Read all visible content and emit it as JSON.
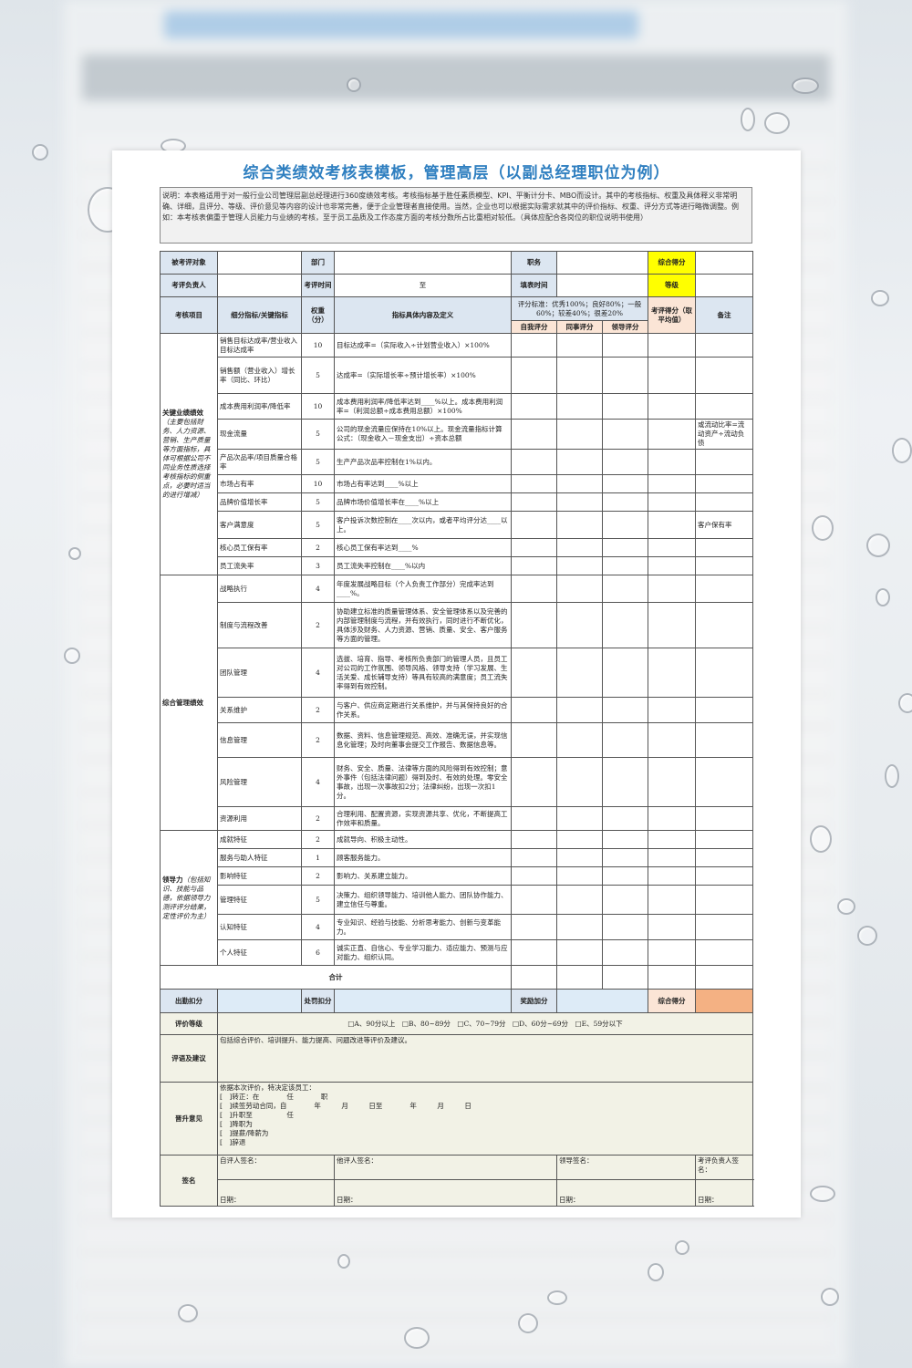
{
  "title": "综合类绩效考核表模板，管理高层（以副总经理职位为例）",
  "description": "说明：本表格适用于对一般行业公司管理层副总经理进行360度绩效考核。考核指标基于胜任素质模型、KPI、平衡计分卡、MBO而设计。其中的考核指标、权重及具体释义非常明确、详细，且评分、等级、评价意见等内容的设计也非常完善，便于企业管理者直接使用。当然，企业也可以根据实际需求就其中的评价指标、权重、评分方式等进行略微调整。例如：本考核表偏重于管理人员能力与业绩的考核，至于员工品质及工作态度方面的考核分数所占比重相对较低。（具体应配合各岗位的职位说明书使用）",
  "header": {
    "target_label": "被考评对象",
    "dept_label": "部门",
    "position_label": "职务",
    "total_score_label": "综合得分",
    "owner_label": "考评负责人",
    "period_label": "考评时间",
    "to_label": "至",
    "fill_time_label": "填表时间",
    "grade_label": "等级"
  },
  "columns": {
    "item": "考核项目",
    "sub": "细分指标/关键指标",
    "weight": "权重（分）",
    "definition": "指标具体内容及定义",
    "standard": "评分标准：优秀100%；良好80%；一般60%；较差40%；很差20%",
    "self": "自我评分",
    "peer": "同事评分",
    "leader": "领导评分",
    "score": "考评得分（取平均值）",
    "remark": "备注"
  },
  "sections": [
    {
      "name": "关键业绩绩效",
      "note": "（主要包括财务、人力资源、营销、生产质量等方面指标，具体可根据公司不同业务性质选择考核指标的侧重点，必要时适当的进行增减）",
      "rows": [
        {
          "sub": "销售目标达成率/营业收入目标达成率",
          "weight": "10",
          "def": "目标达成率=（实际收入÷计划营业收入）×100%",
          "remark": ""
        },
        {
          "sub": "销售额（营业收入）增长率（同比、环比）",
          "weight": "5",
          "def": "达成率=（实际增长率÷预计增长率）×100%",
          "remark": ""
        },
        {
          "sub": "成本费用利润率/降低率",
          "weight": "10",
          "def": "成本费用利润率/降低率达到____%以上。成本费用利润率=（利润总额÷成本费用总额）×100%",
          "remark": ""
        },
        {
          "sub": "现金流量",
          "weight": "5",
          "def": "公司的现金流量应保持在10%以上。现金流量指标计算公式：（现金收入－现金支出）÷资本总额",
          "remark": "或流动比率=流动资产÷流动负债"
        },
        {
          "sub": "产品次品率/项目质量合格率",
          "weight": "5",
          "def": "生产产品次品率控制在1%以内。",
          "remark": ""
        },
        {
          "sub": "市场占有率",
          "weight": "10",
          "def": "市场占有率达到____%以上",
          "remark": ""
        },
        {
          "sub": "品牌价值增长率",
          "weight": "5",
          "def": "品牌市场价值增长率在____%以上",
          "remark": ""
        },
        {
          "sub": "客户满意度",
          "weight": "5",
          "def": "客户投诉次数控制在____次以内，或者平均评分达____以上。",
          "remark": "客户保有率"
        },
        {
          "sub": "核心员工保有率",
          "weight": "2",
          "def": "核心员工保有率达到____%",
          "remark": ""
        },
        {
          "sub": "员工流失率",
          "weight": "3",
          "def": "员工流失率控制在____%以内",
          "remark": ""
        }
      ]
    },
    {
      "name": "综合管理绩效",
      "note": "",
      "rows": [
        {
          "sub": "战略执行",
          "weight": "4",
          "def": "年度发展战略目标（个人负责工作部分）完成率达到____%。",
          "remark": ""
        },
        {
          "sub": "制度与流程改善",
          "weight": "2",
          "def": "协助建立标准的质量管理体系、安全管理体系以及完善的内部管理制度与流程，并有效执行，同时进行不断优化，具体涉及财务、人力资源、营销、质量、安全、客户服务等方面的管理。",
          "remark": ""
        },
        {
          "sub": "团队管理",
          "weight": "4",
          "def": "选拔、培育、指导、考核所负责部门的管理人员，且员工对公司的工作氛围、领导风格、领导支持（学习发展、生活关爱、成长辅导支持）等具有较高的满意度；员工流失率得到有效控制。",
          "remark": ""
        },
        {
          "sub": "关系维护",
          "weight": "2",
          "def": "与客户、供应商定期进行关系维护，并与其保持良好的合作关系。",
          "remark": ""
        },
        {
          "sub": "信息管理",
          "weight": "2",
          "def": "数据、资料、信息管理规范、高效、准确无误，并实现信息化管理；及时向董事会提交工作报告、数据信息等。",
          "remark": ""
        },
        {
          "sub": "风险管理",
          "weight": "4",
          "def": "财务、安全、质量、法律等方面的风险得到有效控制；意外事件（包括法律问题）得到及时、有效的处理。零安全事故，出现一次事故扣2分；法律纠纷，出现一次扣1分。",
          "remark": ""
        },
        {
          "sub": "资源利用",
          "weight": "2",
          "def": "合理利用、配置资源，实现资源共享、优化，不断提高工作效率和质量。",
          "remark": ""
        }
      ]
    },
    {
      "name": "领导力",
      "note": "（包括知识、技能与品德，依据领导力测评评分结果，定性评价为主）",
      "rows": [
        {
          "sub": "成就特征",
          "weight": "2",
          "def": "成就导向、积极主动性。",
          "remark": ""
        },
        {
          "sub": "服务与助人特征",
          "weight": "1",
          "def": "顾客服务能力。",
          "remark": ""
        },
        {
          "sub": "影响特征",
          "weight": "2",
          "def": "影响力、关系建立能力。",
          "remark": ""
        },
        {
          "sub": "管理特征",
          "weight": "5",
          "def": "决策力、组织领导能力、培训他人能力、团队协作能力、建立信任与尊重。",
          "remark": ""
        },
        {
          "sub": "认知特征",
          "weight": "4",
          "def": "专业知识、经验与技能、分析思考能力、创新与变革能力。",
          "remark": ""
        },
        {
          "sub": "个人特征",
          "weight": "6",
          "def": "诚实正直、自信心、专业学习能力、适应能力、预测与应对能力、组织认同。",
          "remark": ""
        }
      ]
    }
  ],
  "footer": {
    "total_label": "合计",
    "attendance_label": "出勤扣分",
    "penalty_label": "处罚扣分",
    "reward_label": "奖励加分",
    "total_score_label": "综合得分",
    "grade_label": "评价等级",
    "grade_options": "□A、90分以上　□B、80~89分　□C、70~79分　□D、60分~69分　□E、59分以下",
    "comment_label": "评语及建议",
    "comment_text": "包括综合评价、培训提升、能力提高、问题改进等评价及建议。",
    "promotion_label": "晋升意见",
    "promotion_lines": [
      "依据本次评价，特决定该员工：",
      "[　]转正：在　　　　任　　　　职",
      "[　]续签劳动合同，自　　　　年　　　月　　　日至　　　　年　　　月　　　日",
      "[　]升职至　　　　　任",
      "[　]降职为",
      "[　]提薪/降薪为",
      "[　]辞退"
    ],
    "sign_label": "签名",
    "signs": [
      "自评人签名：",
      "他评人签名：",
      "领导签名：",
      "考评负责人签名："
    ],
    "date_label": "日期："
  }
}
